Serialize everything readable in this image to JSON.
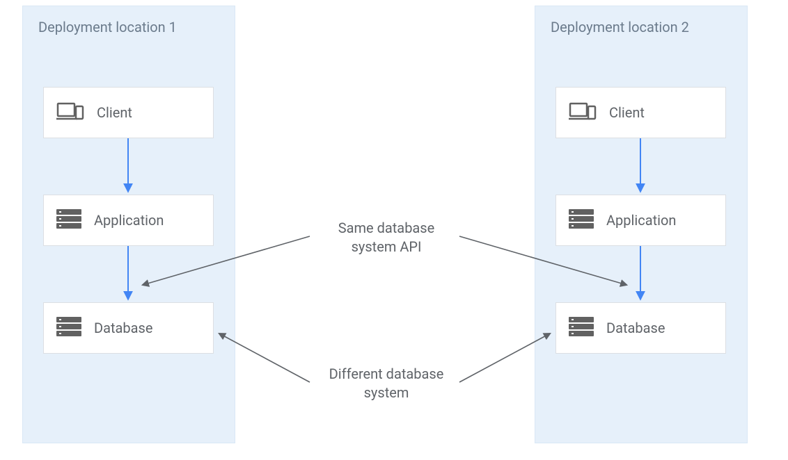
{
  "zones": {
    "left": {
      "title": "Deployment location 1"
    },
    "right": {
      "title": "Deployment location 2"
    }
  },
  "nodes": {
    "left": {
      "client": {
        "label": "Client"
      },
      "application": {
        "label": "Application"
      },
      "database": {
        "label": "Database"
      }
    },
    "right": {
      "client": {
        "label": "Client"
      },
      "application": {
        "label": "Application"
      },
      "database": {
        "label": "Database"
      }
    }
  },
  "annotations": {
    "same_api": "Same database\nsystem API",
    "different_db": "Different database\nsystem"
  },
  "colors": {
    "zone_bg": "#e6f0fa",
    "arrow_blue": "#4285f4",
    "arrow_gray": "#5f6368",
    "icon_gray": "#616161"
  }
}
